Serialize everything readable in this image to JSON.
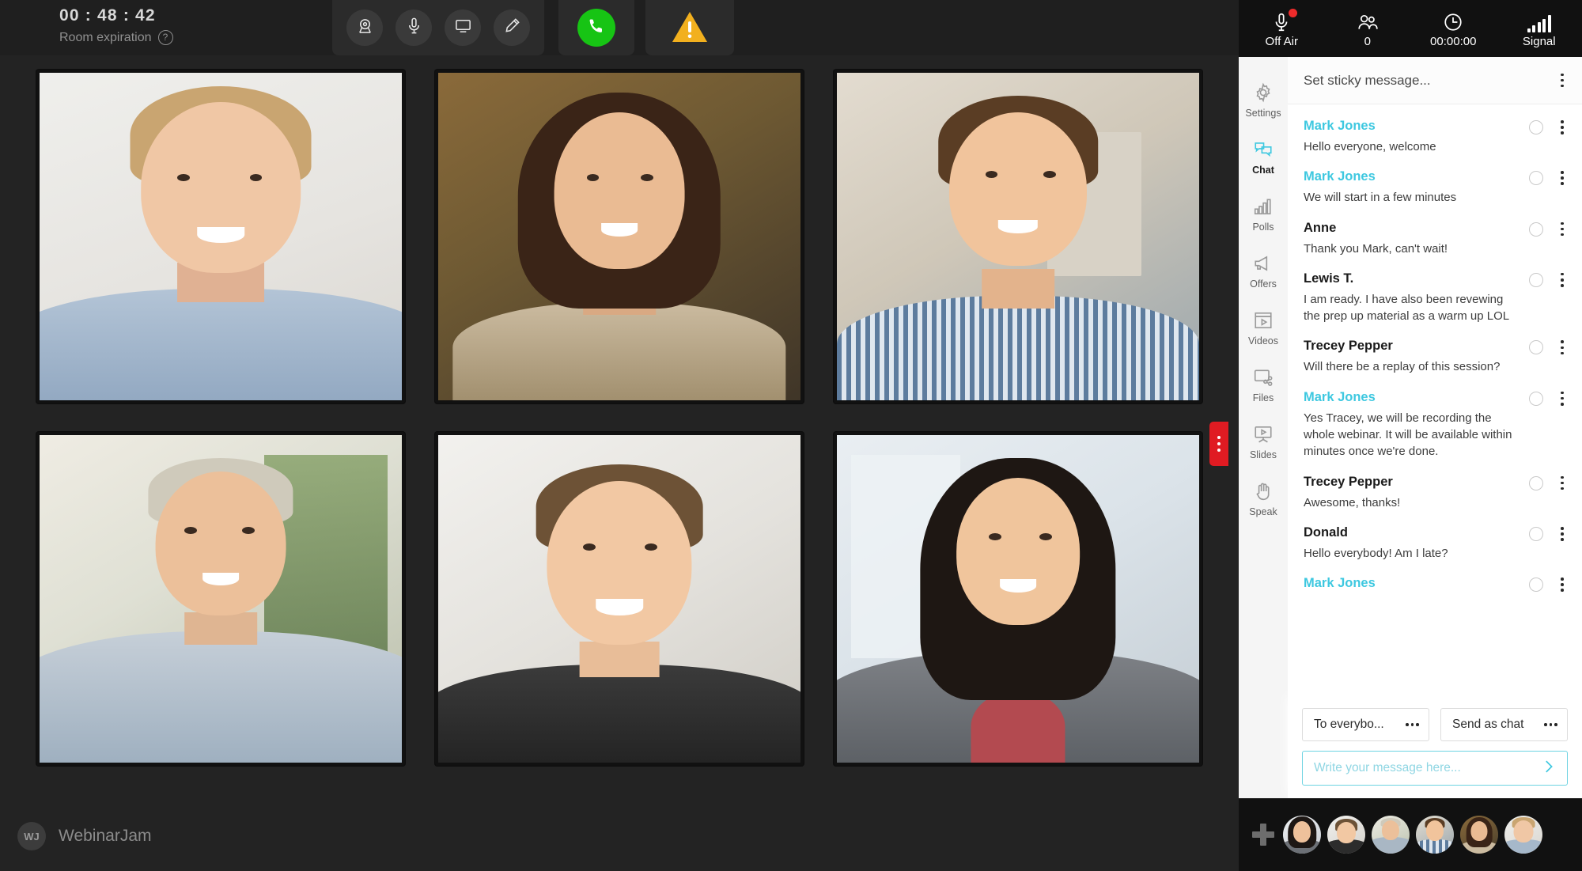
{
  "header": {
    "timer_value": "00 : 48 : 42",
    "timer_label": "Room expiration",
    "help_glyph": "?",
    "tools": [
      {
        "name": "camera-icon",
        "label": "Camera"
      },
      {
        "name": "microphone-icon",
        "label": "Microphone"
      },
      {
        "name": "screen-share-icon",
        "label": "Share screen"
      },
      {
        "name": "annotate-pen-icon",
        "label": "Annotate"
      }
    ],
    "call_button": {
      "name": "phone-icon",
      "label": "Call",
      "color": "#17c414"
    },
    "warning_button": {
      "name": "warning-triangle-icon",
      "label": "Warning",
      "color": "#f2b01e"
    }
  },
  "status": {
    "items": [
      {
        "icon": "microphone-icon",
        "label": "Off Air",
        "alert": true
      },
      {
        "icon": "attendees-icon",
        "label": "0",
        "alert": false
      },
      {
        "icon": "clock-icon",
        "label": "00:00:00",
        "alert": false
      },
      {
        "icon": "signal-bars-icon",
        "label": "Signal",
        "alert": false
      }
    ],
    "alert_color": "#ef2b2b"
  },
  "nav": {
    "active": "Chat",
    "accent": "#3ec8e0",
    "items": [
      {
        "icon": "gear-icon",
        "label": "Settings"
      },
      {
        "icon": "chat-bubbles-icon",
        "label": "Chat"
      },
      {
        "icon": "bar-chart-icon",
        "label": "Polls"
      },
      {
        "icon": "megaphone-icon",
        "label": "Offers"
      },
      {
        "icon": "clapperboard-icon",
        "label": "Videos"
      },
      {
        "icon": "file-share-icon",
        "label": "Files"
      },
      {
        "icon": "presentation-icon",
        "label": "Slides"
      },
      {
        "icon": "raised-hand-icon",
        "label": "Speak"
      }
    ]
  },
  "chat": {
    "sticky_placeholder": "Set sticky message...",
    "host_name": "Mark Jones",
    "host_color": "#3ec8e0",
    "messages": [
      {
        "name": "Mark Jones",
        "text": "Hello everyone, welcome",
        "host": true
      },
      {
        "name": "Mark Jones",
        "text": "We will start in a few minutes",
        "host": true
      },
      {
        "name": "Anne",
        "text": "Thank you Mark, can't wait!",
        "host": false
      },
      {
        "name": "Lewis T.",
        "text": "I am ready. I have also been revewing the prep up material as a warm up LOL",
        "host": false
      },
      {
        "name": "Trecey Pepper",
        "text": "Will there be a replay of this session?",
        "host": false
      },
      {
        "name": "Mark Jones",
        "text": "Yes Tracey, we will be recording the whole webinar. It will be available within minutes once we're done.",
        "host": true
      },
      {
        "name": "Trecey Pepper",
        "text": "Awesome, thanks!",
        "host": false
      },
      {
        "name": "Donald",
        "text": "Hello everybody! Am I late?",
        "host": false
      },
      {
        "name": "Mark Jones",
        "text": "",
        "host": true
      }
    ]
  },
  "composer": {
    "audience_selector": "To everybo...",
    "mode_selector": "Send as chat",
    "input_value": "",
    "input_placeholder": "Write your message here...",
    "send_icon": "send-chevron-icon"
  },
  "handle": {
    "name": "panel-collapse-handle",
    "color": "#e01b22"
  },
  "brand": {
    "badge": "WJ",
    "name": "WebinarJam"
  },
  "avatar_bar": {
    "add_label": "+",
    "avatars": [
      {
        "label": "Participant 1"
      },
      {
        "label": "Participant 2"
      },
      {
        "label": "Participant 3"
      },
      {
        "label": "Participant 4"
      },
      {
        "label": "Participant 5"
      },
      {
        "label": "Participant 6"
      }
    ]
  },
  "video_grid": {
    "tiles": [
      {
        "label": "Participant 1 video"
      },
      {
        "label": "Participant 2 video"
      },
      {
        "label": "Participant 3 video"
      },
      {
        "label": "Participant 4 video"
      },
      {
        "label": "Participant 5 video"
      },
      {
        "label": "Participant 6 video"
      }
    ]
  }
}
